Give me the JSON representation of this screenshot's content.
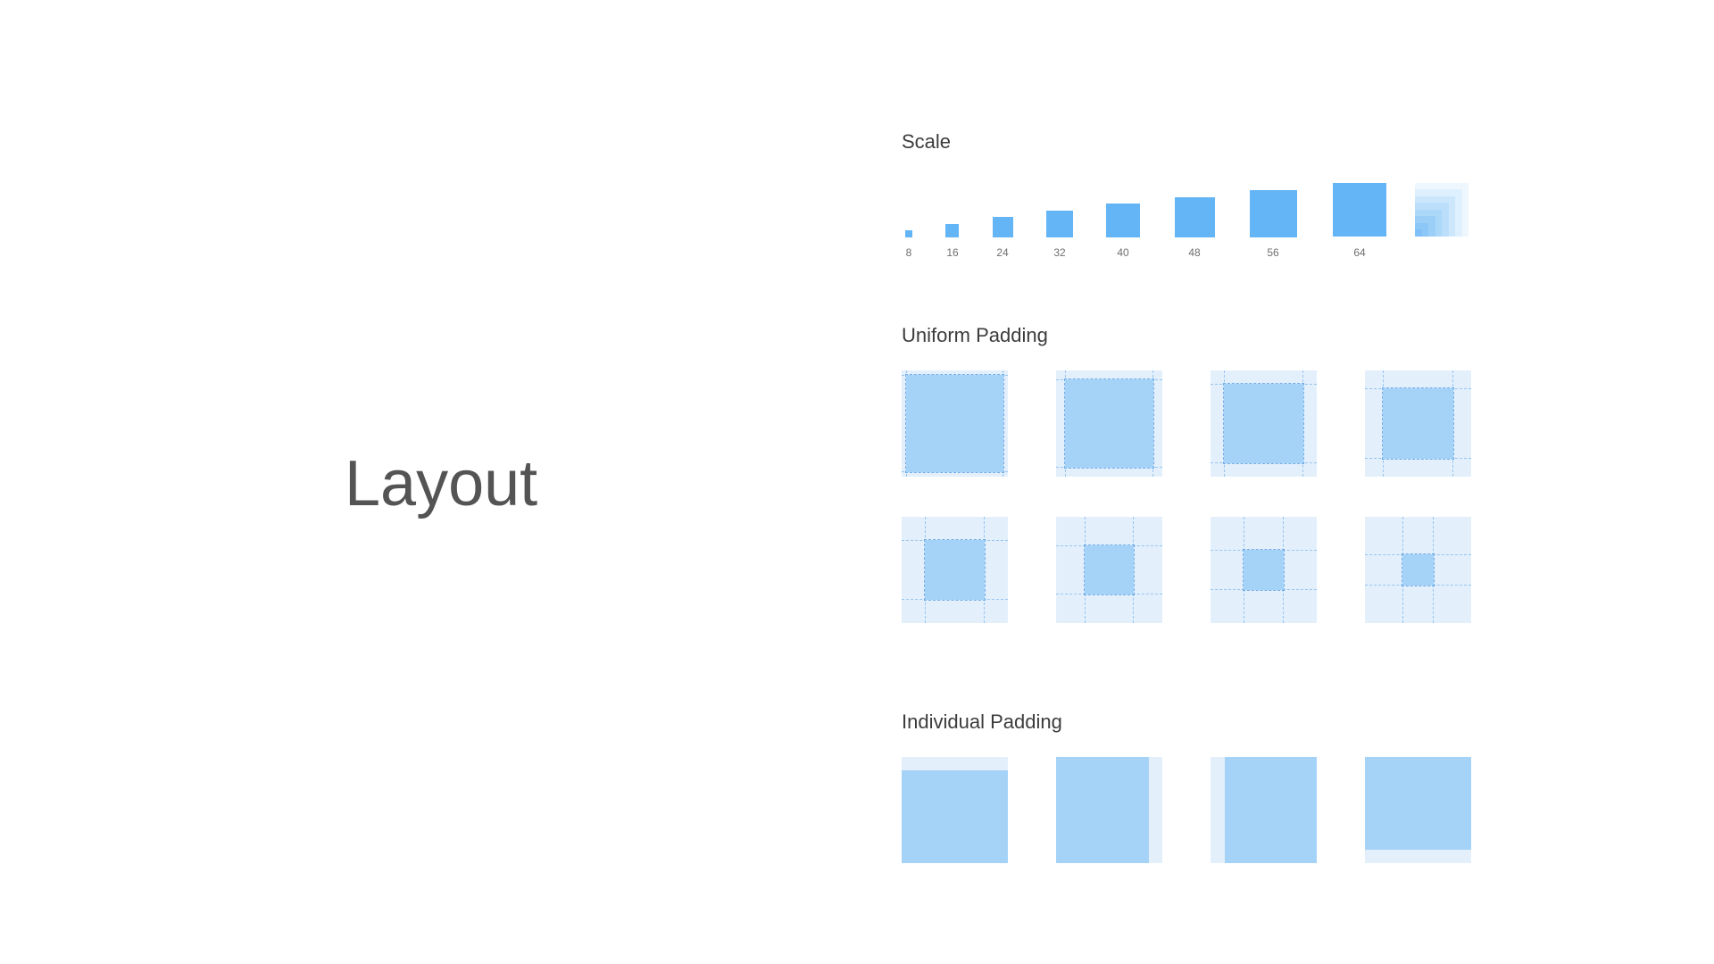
{
  "page": {
    "title": "Layout"
  },
  "sections": {
    "scale": {
      "heading": "Scale"
    },
    "uniform_padding": {
      "heading": "Uniform Padding"
    },
    "individual_padding": {
      "heading": "Individual Padding"
    }
  },
  "scale_steps": [
    "8",
    "16",
    "24",
    "32",
    "40",
    "48",
    "56",
    "64"
  ],
  "colors": {
    "accent": "#64b5f6",
    "content": "#a5d3f8",
    "padding": "#e3f0fc",
    "title_text": "#545454"
  }
}
